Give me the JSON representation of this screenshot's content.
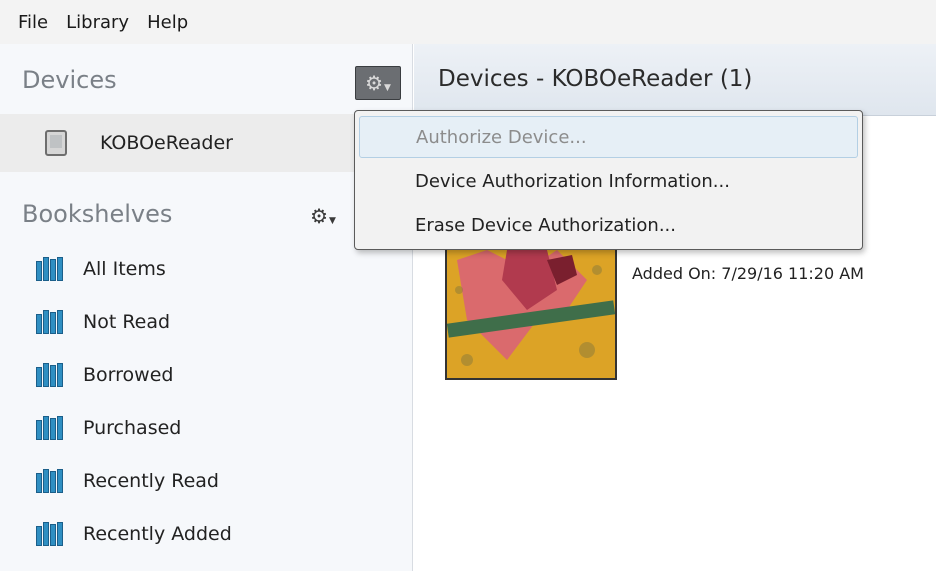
{
  "menubar": {
    "items": [
      "File",
      "Library",
      "Help"
    ]
  },
  "sidebar": {
    "devices_title": "Devices",
    "device_name": "KOBOeReader",
    "bookshelves_title": "Bookshelves",
    "shelves": [
      "All Items",
      "Not Read",
      "Borrowed",
      "Purchased",
      "Recently Read",
      "Recently Added"
    ]
  },
  "main": {
    "title": "Devices - KOBOeReader (1)",
    "book": {
      "added_on": "Added On:  7/29/16 11:20 AM"
    }
  },
  "context_menu": {
    "items": [
      {
        "label": "Authorize Device...",
        "enabled": false
      },
      {
        "label": "Device Authorization Information...",
        "enabled": true
      },
      {
        "label": "Erase Device Authorization...",
        "enabled": true
      }
    ]
  },
  "icons": {
    "gear": "gear-icon",
    "device": "ereader-device-icon",
    "shelf": "bookshelf-icon"
  },
  "colors": {
    "shelf_icon": "#2f8fc2",
    "sidebar_bg": "#f6f8fb",
    "menu_hover": "#e6eff6"
  }
}
